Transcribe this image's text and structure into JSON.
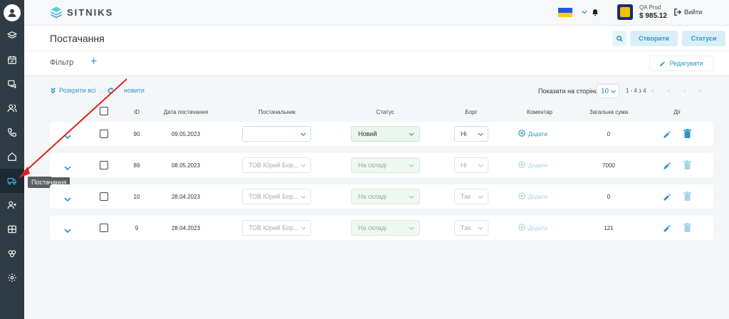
{
  "app": {
    "logo_text": "SITNIKS"
  },
  "account": {
    "name": "QA Prod",
    "balance": "$ 985.12",
    "logout_label": "Вийти"
  },
  "page": {
    "title": "Постачання"
  },
  "header_buttons": {
    "create": "Створити",
    "statuses": "Статуси"
  },
  "filter": {
    "label": "Фільтр",
    "add": "+",
    "edit": "Редагувати"
  },
  "toolbar": {
    "expand_all": "Розкрити всі",
    "refresh": "новити",
    "per_page_label": "Показати на сторінці",
    "per_page_value": "10",
    "range": "1 - 4 з 4",
    "pager": [
      "«",
      "‹",
      "›",
      "»"
    ]
  },
  "sidebar": {
    "tooltip": "Постачання",
    "items": [
      "layers-icon",
      "calendar-icon",
      "chat-icon",
      "users-icon",
      "phone-icon",
      "home-icon",
      "truck-icon",
      "user-add-icon",
      "table-icon",
      "crm-icon",
      "gear-icon"
    ],
    "active": "truck-icon"
  },
  "table": {
    "columns": [
      "ID",
      "Дата постачання",
      "Постачальник",
      "Статус",
      "Борг",
      "Коментар",
      "Загальна сума",
      "Дії"
    ],
    "rows": [
      {
        "id": "90",
        "date": "09.05.2023",
        "supplier": "",
        "status": "Новий",
        "debt": "Ні",
        "comment": "Додати",
        "total": "0",
        "dim": false
      },
      {
        "id": "89",
        "date": "08.05.2023",
        "supplier": "ТОВ Юрий Бор...",
        "status": "На складі",
        "debt": "Ні",
        "comment": "Додати",
        "total": "7000",
        "dim": true
      },
      {
        "id": "10",
        "date": "28.04.2023",
        "supplier": "ТОВ Юрий Бор...",
        "status": "На складі",
        "debt": "Так",
        "comment": "Додати",
        "total": "0",
        "dim": true
      },
      {
        "id": "9",
        "date": "28.04.2023",
        "supplier": "ТОВ Юрий Бор...",
        "status": "На складі",
        "debt": "Так",
        "comment": "Додати",
        "total": "121",
        "dim": true
      }
    ]
  },
  "colors": {
    "accent": "#2b98c8",
    "sidebar": "#2f3b44",
    "status_green": "#39b86a",
    "arrow": "#e02020"
  }
}
